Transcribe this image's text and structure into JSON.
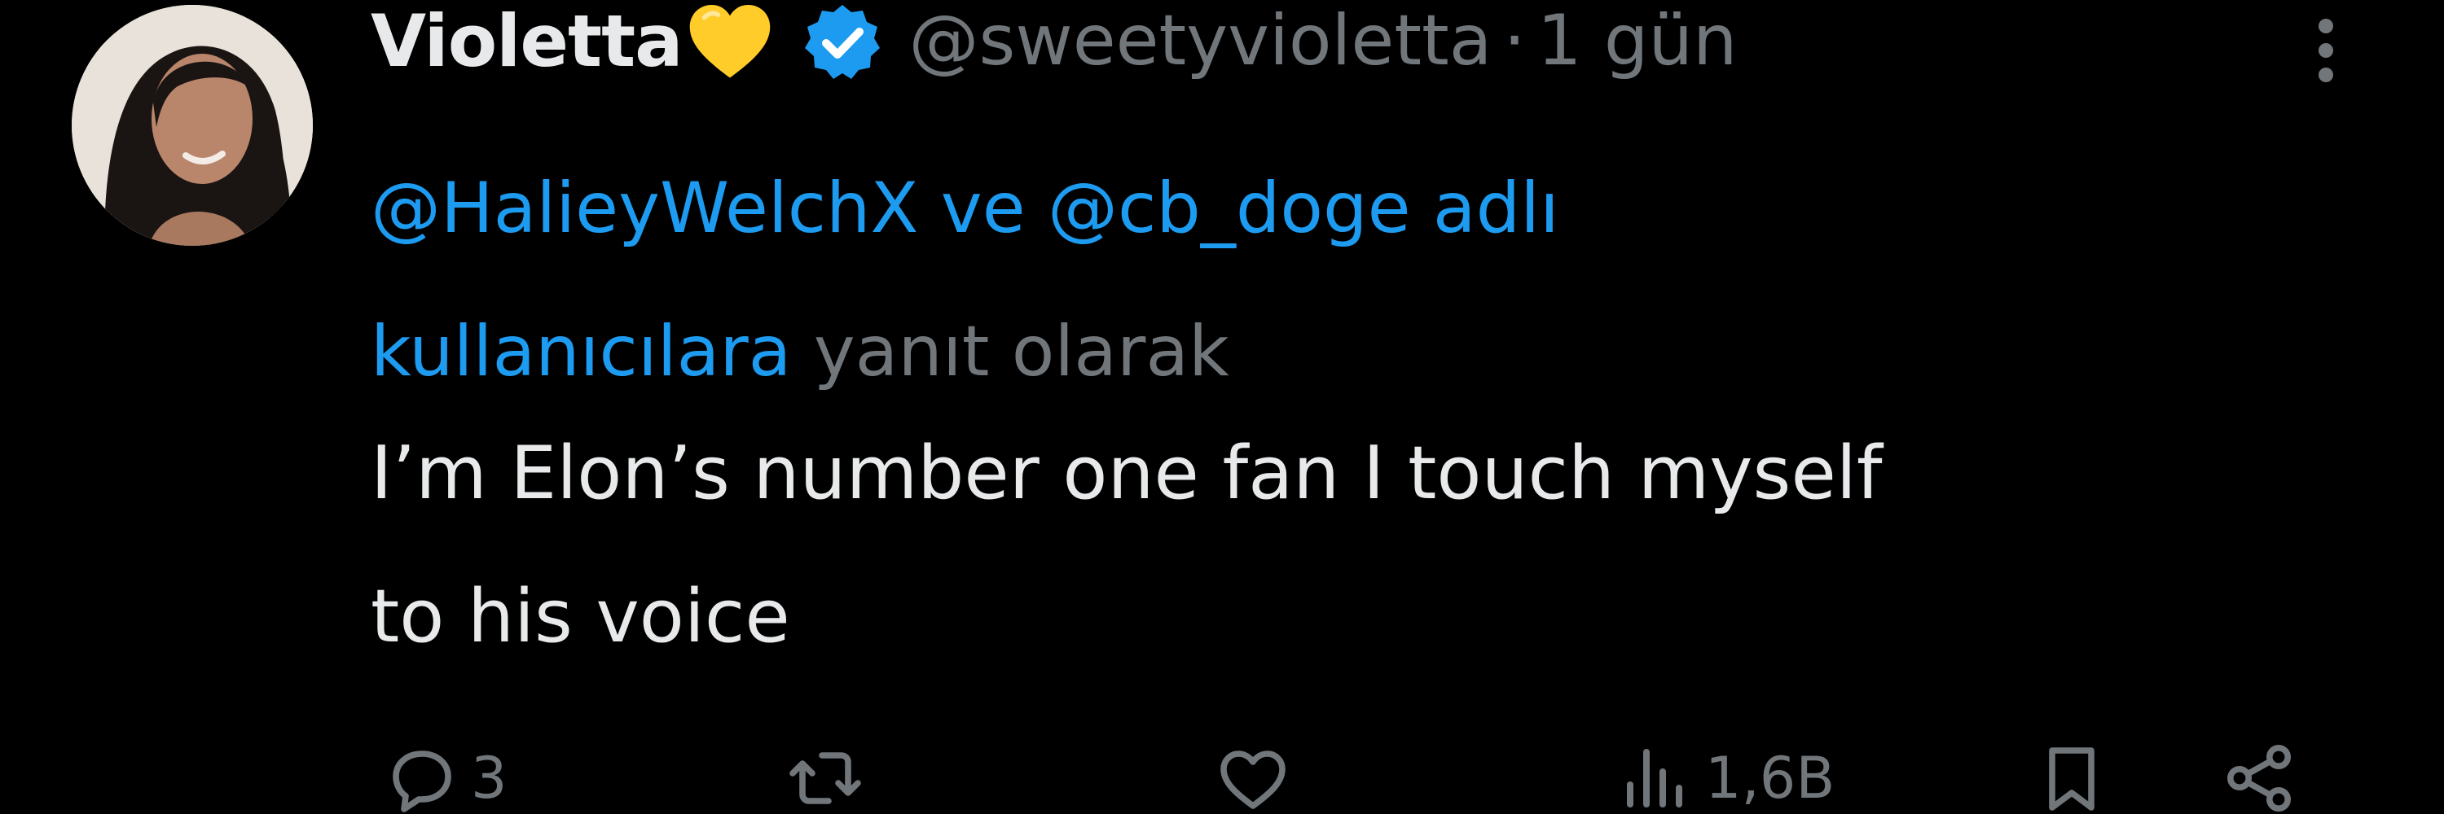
{
  "tweet": {
    "display_name": "Violetta",
    "name_emoji": "yellow-heart-icon",
    "verified": "verified-badge-icon",
    "handle": "@sweetyvioletta",
    "separator": "·",
    "time": "1 gün",
    "reply_to": {
      "mention_1": "@HalieyWelchX",
      "joiner": " ve ",
      "mention_2": "@cb_doge adlı kullanıcılara",
      "suffix": " yanıt olarak"
    },
    "text_line_1": "I’m Elon’s number one fan I touch myself",
    "text_line_2": "to his voice",
    "actions": {
      "reply_count": "3",
      "retweet_count": "",
      "like_count": "",
      "views_count": "1,6B"
    }
  },
  "colors": {
    "background": "#000000",
    "primary_text": "#e7e9ea",
    "secondary_text": "#71767b",
    "link": "#1d9bf0",
    "verified": "#1d9bf0",
    "heart": "#ffcc2a"
  }
}
